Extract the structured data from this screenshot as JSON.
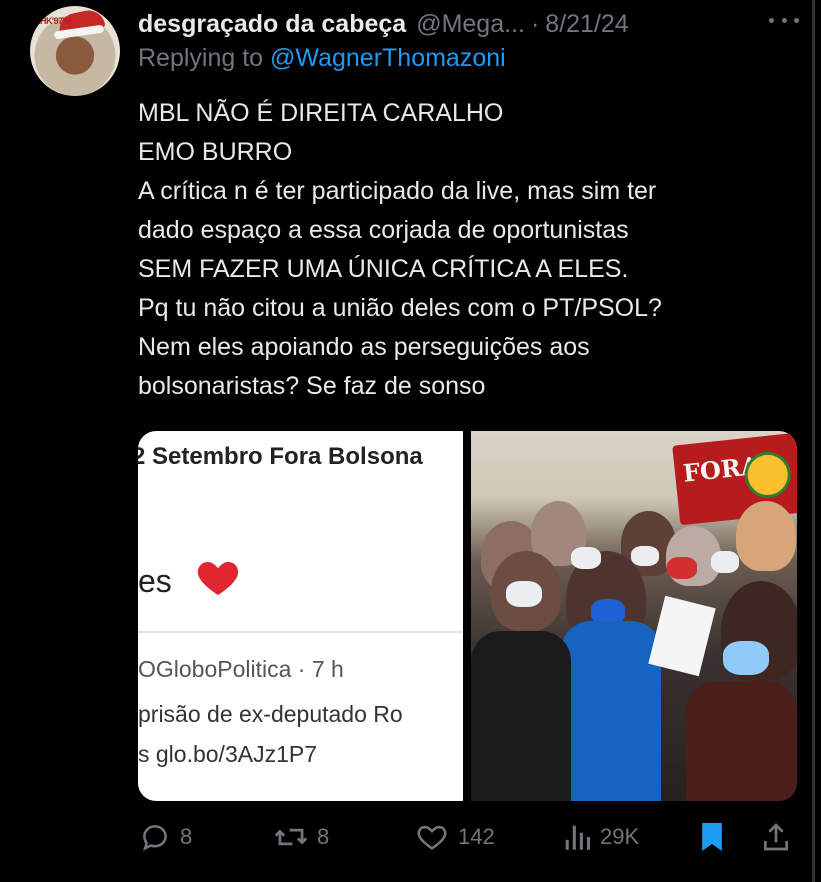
{
  "tweet": {
    "display_name": "desgraçado da cabeça",
    "handle": "@Mega...",
    "separator": "·",
    "date": "8/21/24",
    "replying_label": "Replying to",
    "replying_to": "@WagnerThomazoni",
    "text_lines": [
      "MBL NÃO É DIREITA CARALHO",
      "EMO BURRO",
      "A crítica n é ter participado da live, mas sim ter",
      "dado espaço a essa corjada de oportunistas",
      "SEM FAZER UMA ÚNICA CRÍTICA A ELES.",
      "Pq tu não citou a união deles com o PT/PSOL?",
      "Nem eles apoiando as perseguições aos",
      "bolsonaristas? Se faz de sonso"
    ]
  },
  "avatar": {
    "badge": "AHK'97'M"
  },
  "media": {
    "left": {
      "headline": "2 Setembro Fora Bolsona",
      "text": "es",
      "source": "OGloboPolitica · 7 h",
      "line1": "prisão de ex-deputado Ro",
      "line2": "s  glo.bo/3AJz1P7"
    },
    "right": {
      "banner_text": "FORA"
    }
  },
  "actions": {
    "reply": {
      "icon": "reply-icon",
      "count": "8"
    },
    "repost": {
      "icon": "repost-icon",
      "count": "8"
    },
    "like": {
      "icon": "heart-icon",
      "count": "142"
    },
    "views": {
      "icon": "views-icon",
      "count": "29K"
    },
    "bookmark": {
      "icon": "bookmark-icon",
      "color": "#1d9bf0"
    },
    "share": {
      "icon": "share-icon"
    }
  },
  "colors": {
    "background": "#000000",
    "text": "#e7e9ea",
    "muted": "#71767b",
    "accent": "#1d9bf0",
    "heart": "#e0262e"
  }
}
